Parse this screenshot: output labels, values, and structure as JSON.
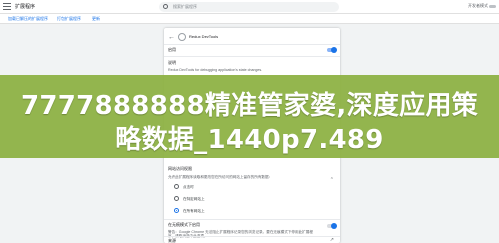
{
  "topbar": {
    "app_title": "扩展程序",
    "search_placeholder": "搜索扩展程序",
    "dev_mode_label": "开发者模式"
  },
  "subbar": {
    "load_unpacked": "加载已解压的扩展程序",
    "pack_extension": "打包扩展程序",
    "update": "更新"
  },
  "detail": {
    "extension_name": "Redux DevTools",
    "on_label": "启用",
    "description_label": "说明",
    "description_text": "Redux DevTools for debugging application's state changes.",
    "site_access_label": "网站访问权限",
    "site_access_question": "允许此扩展程序读取和更改您在所访问的网站上留存的所有数据：",
    "options": [
      "点击时",
      "在特定网站上",
      "在所有网站上"
    ],
    "selected_option_index": 2,
    "incognito_label": "在无痕模式下启用",
    "incognito_text": "警告：Google Chrome 无法阻止扩展程序记录您的浏览记录。要在无痕模式下停用此扩展程序，请取消选中此选项。",
    "source_label": "来源"
  },
  "overlay": {
    "line1": "7777888888精准管家婆,深度应用策",
    "line2": "略数据_1440p7.489"
  },
  "colors": {
    "accent": "#1a73e8",
    "banner": "#8bb03f"
  }
}
